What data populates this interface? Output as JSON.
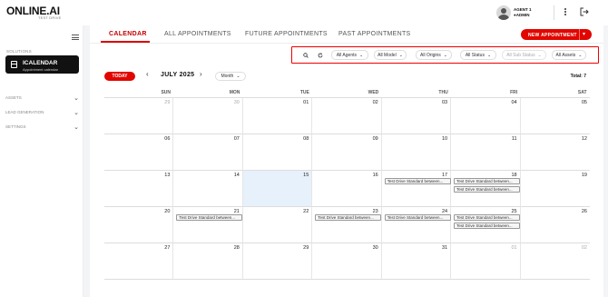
{
  "brand": {
    "name": "ONLINE.AI",
    "tagline": "TEST DRIVE"
  },
  "user": {
    "name": "AGENT 1",
    "role": "ADMIN"
  },
  "sidebar": {
    "solutions_label": "SOLUTIONS",
    "active_item": {
      "title": "ICALENDAR",
      "subtitle": "Appointment calendar"
    },
    "groups": [
      "ASSETS",
      "LEAD GENERATION",
      "SETTINGS"
    ]
  },
  "tabs": [
    {
      "label": "CALENDAR"
    },
    {
      "label": "ALL APPOINTMENTS"
    },
    {
      "label": "FUTURE APPOINTMENTS"
    },
    {
      "label": "PAST APPOINTMENTS"
    }
  ],
  "new_button": "NEW APPOINTMENT",
  "filters": {
    "agents": "All Agents",
    "model": "All Model",
    "origins": "All Origins",
    "status": "All Status",
    "sub_status": "All Sub Status",
    "assets": "All Assets"
  },
  "nav": {
    "today": "TODAY",
    "month": "JULY 2025",
    "view": "Month",
    "total": "Total: 7"
  },
  "weekdays": [
    "SUN",
    "MON",
    "TUE",
    "WED",
    "THU",
    "FRI",
    "SAT"
  ],
  "weeks": [
    [
      "29",
      "30",
      "01",
      "02",
      "03",
      "04",
      "05"
    ],
    [
      "06",
      "07",
      "08",
      "09",
      "10",
      "11",
      "12"
    ],
    [
      "13",
      "14",
      "15",
      "16",
      "17",
      "18",
      "19"
    ],
    [
      "20",
      "21",
      "22",
      "23",
      "24",
      "25",
      "26"
    ],
    [
      "27",
      "28",
      "29",
      "30",
      "31",
      "01",
      "02"
    ]
  ],
  "other_month": [
    [
      0,
      0
    ],
    [
      0,
      1
    ],
    [
      4,
      5
    ],
    [
      4,
      6
    ]
  ],
  "today_cell": [
    2,
    2
  ],
  "events": [
    {
      "week": 2,
      "day": 4,
      "text": "Test Drive Standard between..."
    },
    {
      "week": 2,
      "day": 5,
      "text": "Test Drive Standard between..."
    },
    {
      "week": 2,
      "day": 5,
      "text": "Test Drive Standard between..."
    },
    {
      "week": 3,
      "day": 1,
      "text": "Test Drive Standard between..."
    },
    {
      "week": 3,
      "day": 3,
      "text": "Test Drive Standard between..."
    },
    {
      "week": 3,
      "day": 4,
      "text": "Test Drive Standard between..."
    },
    {
      "week": 3,
      "day": 5,
      "text": "Test Drive Standard between..."
    },
    {
      "week": 3,
      "day": 5,
      "text": "Test Drive Standard between..."
    }
  ],
  "colors": {
    "accent": "#e10600",
    "today_bg": "#e6f1fb"
  }
}
